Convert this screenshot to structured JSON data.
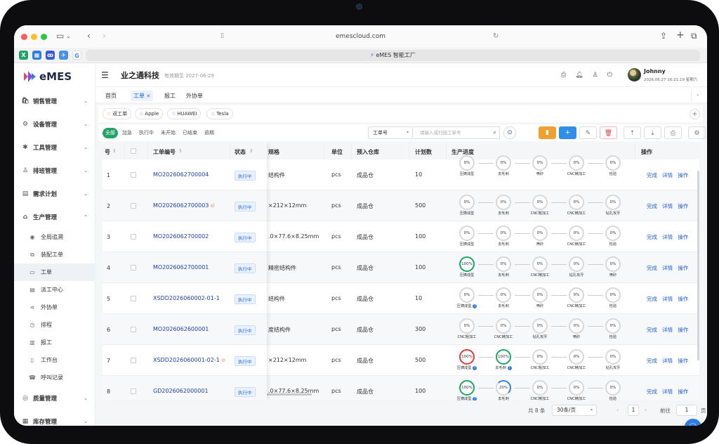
{
  "browser": {
    "url": "emescloud.com",
    "tab_title": "eMES 智能工厂"
  },
  "app": {
    "logo_text": "eMES",
    "company": "业之通科技",
    "validity": "有效期至 2027-06-29",
    "user": {
      "name": "Johnny",
      "datetime": "2026.06.27 16:21:19 星期六"
    }
  },
  "sidebar": {
    "sections": [
      {
        "label": "销售管理",
        "icon": "cart-icon"
      },
      {
        "label": "设备管理",
        "icon": "gear-icon"
      },
      {
        "label": "工具管理",
        "icon": "tool-icon"
      },
      {
        "label": "排班管理",
        "icon": "person-icon"
      },
      {
        "label": "需求计划",
        "icon": "plan-icon"
      },
      {
        "label": "生产管理",
        "icon": "factory-icon"
      }
    ],
    "sub_items": [
      {
        "label": "全局追溯",
        "icon": "eye-icon"
      },
      {
        "label": "装配工单",
        "icon": "assembly-icon"
      },
      {
        "label": "工单",
        "icon": "order-icon"
      },
      {
        "label": "派工中心",
        "icon": "dispatch-icon"
      },
      {
        "label": "外协单",
        "icon": "share-icon"
      },
      {
        "label": "排程",
        "icon": "clock-icon"
      },
      {
        "label": "报工",
        "icon": "report-icon"
      },
      {
        "label": "工作台",
        "icon": "book-icon"
      },
      {
        "label": "呼叫记录",
        "icon": "call-icon"
      }
    ],
    "bottom_sections": [
      {
        "label": "质量管理",
        "icon": "quality-icon"
      },
      {
        "label": "库存管理",
        "icon": "warehouse-icon"
      }
    ]
  },
  "nav_tabs": [
    "首页",
    "工单",
    "报工",
    "外协单"
  ],
  "quick_filters": [
    "返工单",
    "Apple",
    "HUAWEI",
    "Tesla"
  ],
  "status_filters": [
    "全部",
    "加急",
    "执行中",
    "未开始",
    "已结束",
    "逾期"
  ],
  "search": {
    "field": "工单号",
    "placeholder": "请输入或扫描工单号"
  },
  "table": {
    "headers": {
      "no": "号",
      "order": "工单编号",
      "status": "状态",
      "spec": "规格",
      "unit": "单位",
      "warehouse": "预入仓库",
      "qty": "计划数",
      "progress": "生产进度",
      "ops": "操作"
    },
    "ops_labels": [
      "完成",
      "详情",
      "操作"
    ],
    "rows": [
      {
        "no": "1",
        "order": "MO2026062700004",
        "hot": false,
        "status": "执行中",
        "spec": "结构件",
        "unit": "pcs",
        "warehouse": "成品仓",
        "qty": "10",
        "steps": [
          {
            "p": "0%",
            "n": "压铸成型",
            "s": "n"
          },
          {
            "p": "0%",
            "n": "去毛刺",
            "s": "n"
          },
          {
            "p": "0%",
            "n": "喷砂",
            "s": "n"
          },
          {
            "p": "0%",
            "n": "CNC精加工",
            "s": "n"
          },
          {
            "p": "0%",
            "n": "检验",
            "s": "n"
          }
        ]
      },
      {
        "no": "2",
        "order": "MO2026062700003",
        "hot": true,
        "status": "执行中",
        "spec": "×212×12mm",
        "unit": "pcs",
        "warehouse": "成品仓",
        "qty": "500",
        "steps": [
          {
            "p": "0%",
            "n": "压铸成型",
            "s": "n"
          },
          {
            "p": "0%",
            "n": "去毛刺",
            "s": "n"
          },
          {
            "p": "0%",
            "n": "CNC粗加工",
            "s": "n"
          },
          {
            "p": "0%",
            "n": "CNC精加工",
            "s": "n"
          },
          {
            "p": "0%",
            "n": "钻孔攻牙",
            "s": "n"
          }
        ]
      },
      {
        "no": "3",
        "order": "MO2026062700002",
        "hot": false,
        "status": "执行中",
        "spec": ".0×77.6×8.25mm",
        "unit": "pcs",
        "warehouse": "成品仓",
        "qty": "100",
        "steps": [
          {
            "p": "0%",
            "n": "压铸成型",
            "s": "n"
          },
          {
            "p": "0%",
            "n": "去毛刺",
            "s": "n"
          },
          {
            "p": "0%",
            "n": "喷砂",
            "s": "n"
          },
          {
            "p": "0%",
            "n": "CNC精加工",
            "s": "n"
          },
          {
            "p": "0%",
            "n": "检验",
            "s": "n"
          }
        ]
      },
      {
        "no": "4",
        "order": "MO2026062700001",
        "hot": false,
        "status": "执行中",
        "spec": "精密结构件",
        "unit": "pcs",
        "warehouse": "成品仓",
        "qty": "100",
        "steps": [
          {
            "p": "100%",
            "n": "压铸成型",
            "s": "g"
          },
          {
            "p": "0%",
            "n": "去毛刺",
            "s": "n"
          },
          {
            "p": "0%",
            "n": "CNC精加工",
            "s": "n"
          },
          {
            "p": "0%",
            "n": "钻孔攻牙",
            "s": "n"
          },
          {
            "p": "0%",
            "n": "喷砂",
            "s": "n"
          }
        ]
      },
      {
        "no": "5",
        "order": "XSDD2026060002-01-1",
        "hot": false,
        "status": "执行中",
        "spec": "结构件",
        "unit": "pcs",
        "warehouse": "成品仓",
        "qty": "10",
        "steps": [
          {
            "p": "0%",
            "n": "压铸成型",
            "s": "n",
            "q": true
          },
          {
            "p": "0%",
            "n": "去毛刺",
            "s": "n"
          },
          {
            "p": "0%",
            "n": "喷砂",
            "s": "n"
          },
          {
            "p": "0%",
            "n": "CNC精加工",
            "s": "n"
          },
          {
            "p": "0%",
            "n": "检验",
            "s": "n"
          }
        ]
      },
      {
        "no": "6",
        "order": "MO2026062600001",
        "hot": false,
        "status": "执行中",
        "spec": "度结构件",
        "unit": "pcs",
        "warehouse": "成品仓",
        "qty": "300",
        "steps": [
          {
            "p": "0%",
            "n": "CNC粗加工",
            "s": "n"
          },
          {
            "p": "0%",
            "n": "CNC精加工",
            "s": "n"
          },
          {
            "p": "0%",
            "n": "钻孔攻牙",
            "s": "n"
          },
          {
            "p": "0%",
            "n": "喷砂",
            "s": "n"
          },
          {
            "p": "0%",
            "n": "检验",
            "s": "n"
          }
        ]
      },
      {
        "no": "7",
        "order": "XSDD2026060001-02-1",
        "hot": true,
        "status": "执行中",
        "spec": "×212×12mm",
        "unit": "pcs",
        "warehouse": "成品仓",
        "qty": "500",
        "steps": [
          {
            "p": "100%",
            "n": "压铸成型",
            "s": "r",
            "q": true
          },
          {
            "p": "100%",
            "n": "去毛刺",
            "s": "g",
            "q": true
          },
          {
            "p": "0%",
            "n": "CNC粗加工",
            "s": "n"
          },
          {
            "p": "0%",
            "n": "CNC精加工",
            "s": "n"
          },
          {
            "p": "0%",
            "n": "钻孔攻牙",
            "s": "n"
          }
        ]
      },
      {
        "no": "8",
        "order": "GD2026062000001",
        "hot": false,
        "status": "执行中",
        "spec": ".0×77.6×8.25mm",
        "unit": "pcs",
        "warehouse": "成品仓",
        "qty": "100",
        "steps": [
          {
            "p": "100%",
            "n": "压铸成型",
            "s": "g",
            "q": true
          },
          {
            "p": "20%",
            "n": "去毛刺",
            "s": "b"
          },
          {
            "p": "0%",
            "n": "CNC精加工",
            "s": "n"
          },
          {
            "p": "0%",
            "n": "CNC精加工",
            "s": "n"
          },
          {
            "p": "0%",
            "n": "检验",
            "s": "n"
          }
        ]
      }
    ]
  },
  "pagination": {
    "total": "共 8 条",
    "page_size": "30条/页",
    "current": "1",
    "goto_label": "前往",
    "goto_value": "1",
    "page_suffix": "页"
  },
  "colors": {
    "primary": "#1f5fd1",
    "green": "#21a366",
    "red": "#e03a3a",
    "orange": "#f0a030"
  }
}
